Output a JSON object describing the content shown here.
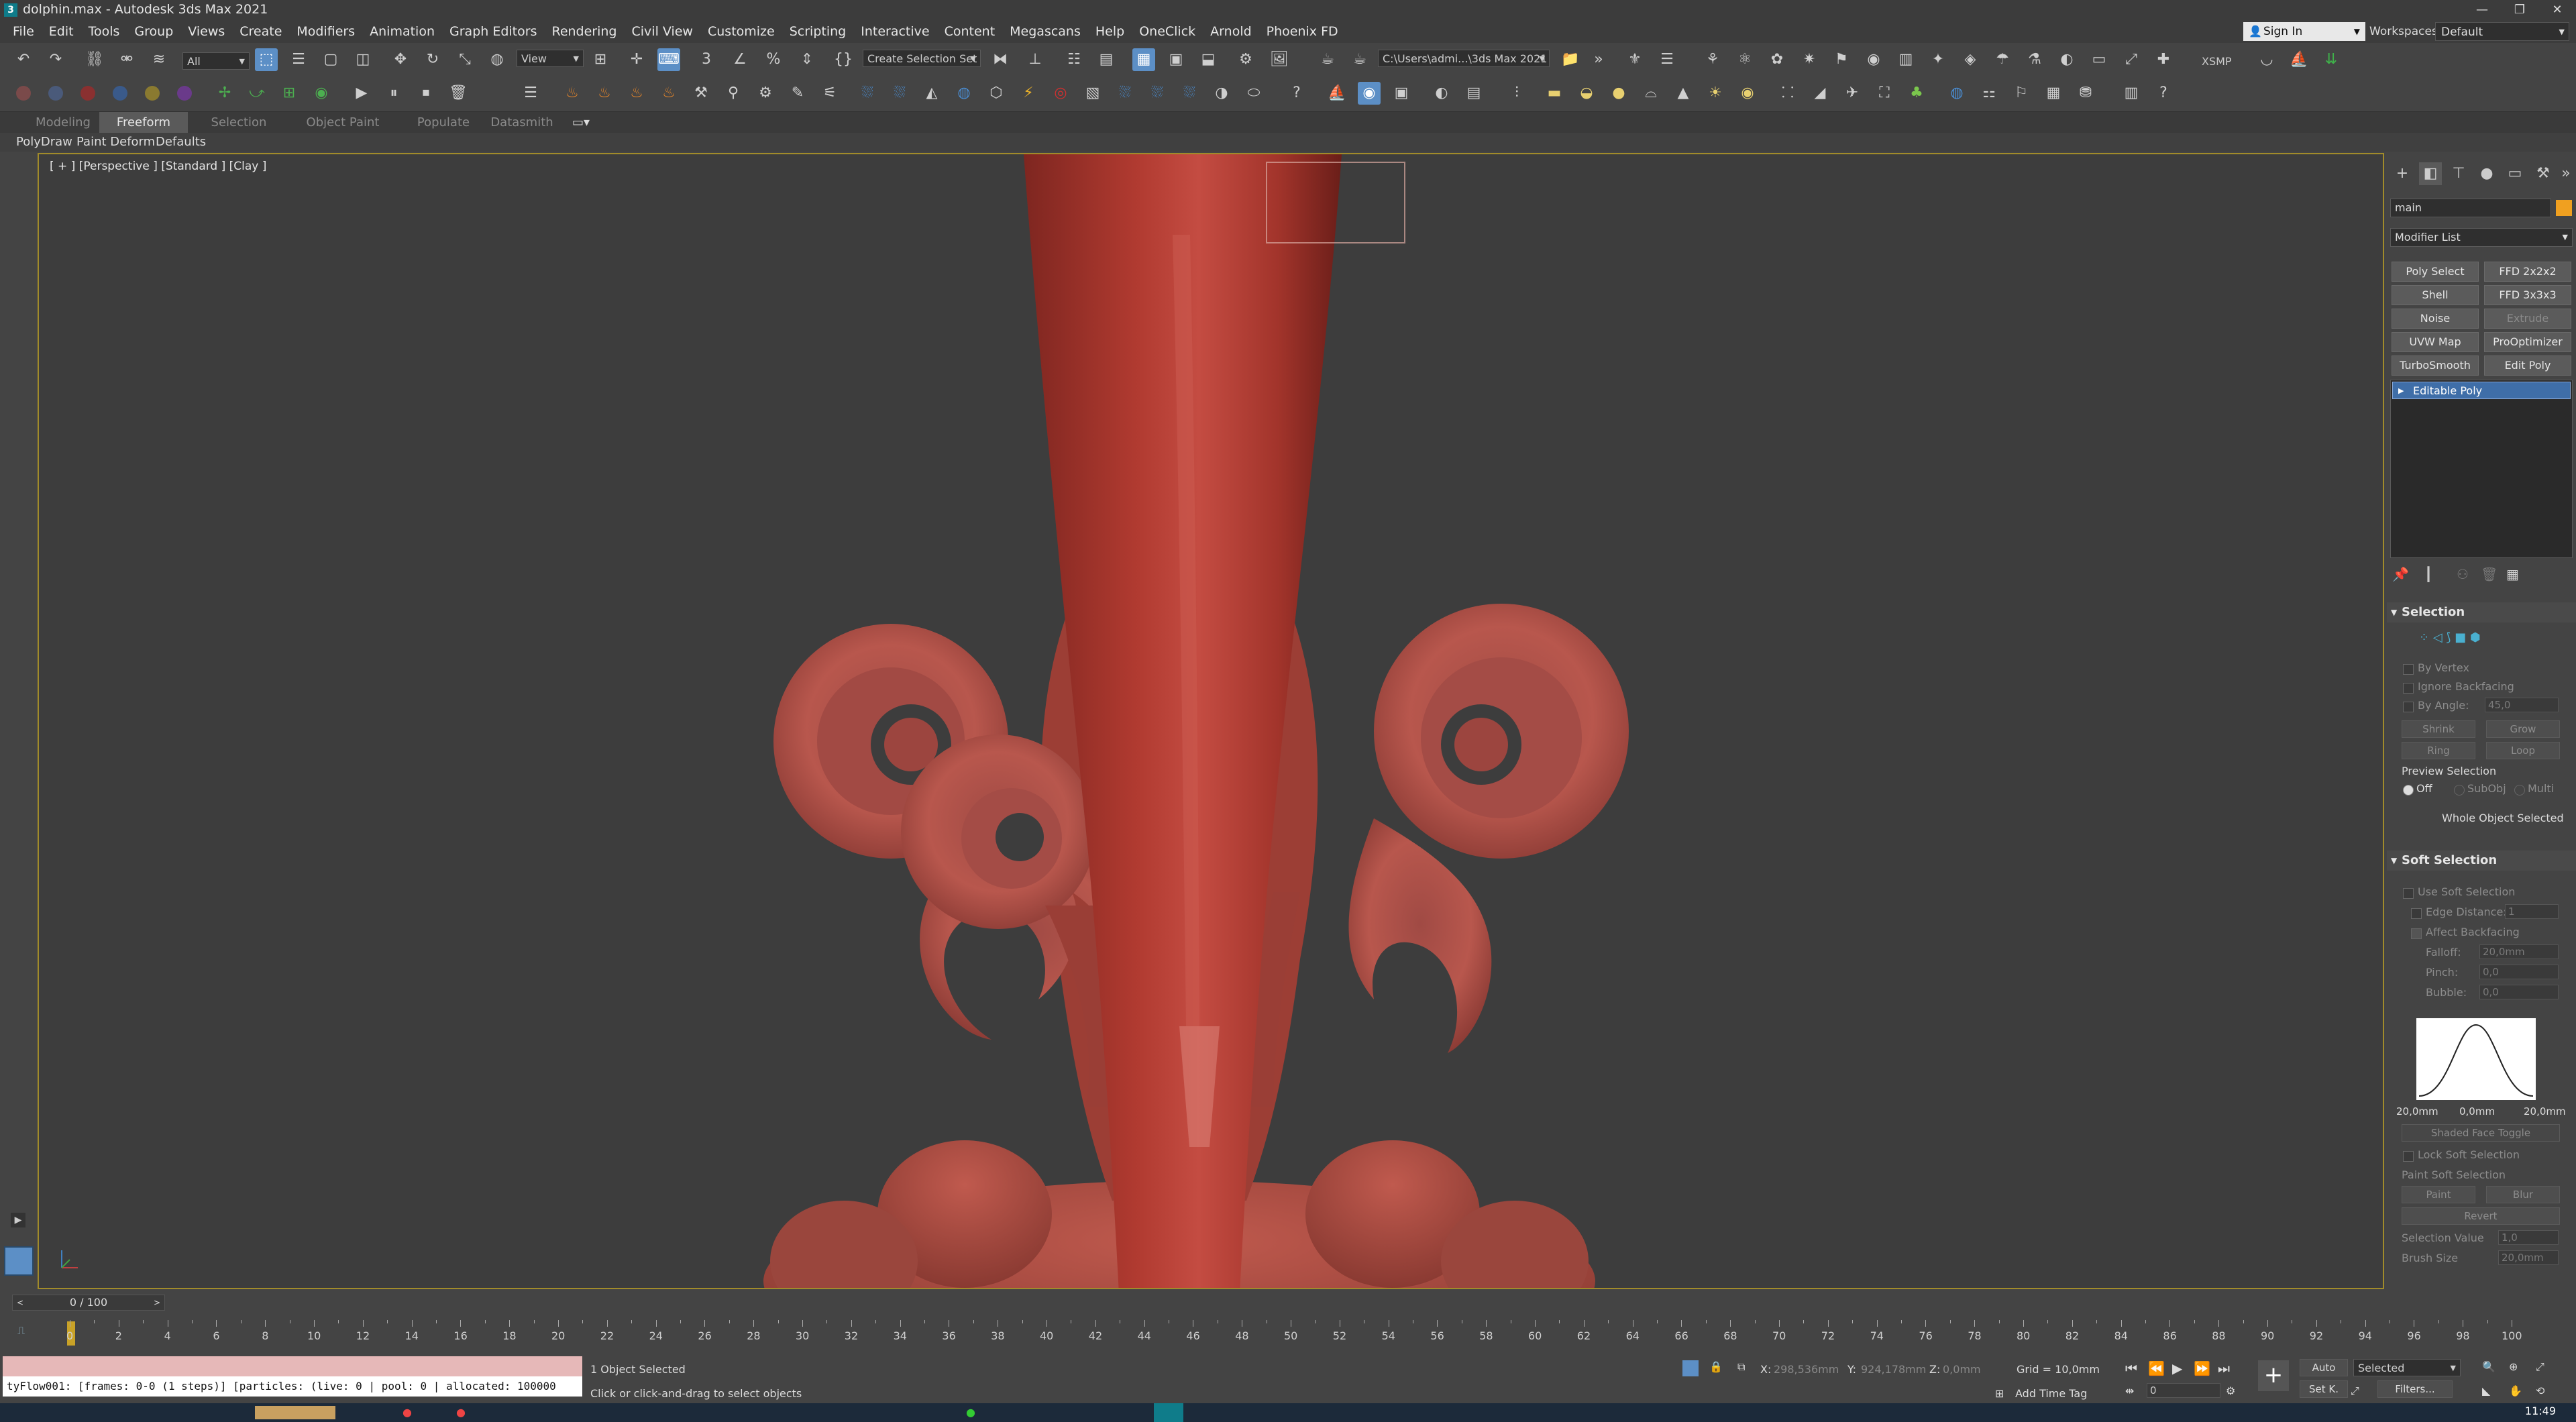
{
  "window": {
    "title": "dolphin.max - Autodesk 3ds Max 2021",
    "app_icon_glyph": "3",
    "minimize": "—",
    "restore": "❐",
    "close": "✕"
  },
  "menu": [
    "File",
    "Edit",
    "Tools",
    "Group",
    "Views",
    "Create",
    "Modifiers",
    "Animation",
    "Graph Editors",
    "Rendering",
    "Civil View",
    "Customize",
    "Scripting",
    "Interactive",
    "Content",
    "Megascans",
    "Help",
    "OneClick",
    "Arnold",
    "Phoenix FD"
  ],
  "signin": {
    "label": "Sign In"
  },
  "workspaces": {
    "label": "Workspaces:",
    "value": "Default"
  },
  "toolbar": {
    "filter_select": "All",
    "view_select": "View",
    "selection_set": "Create Selection Set",
    "project_path": "C:\\Users\\admi...\\3ds Max 2021",
    "xsmp": "XSMP",
    "icons": [
      "undo-icon",
      "redo-icon",
      "link-icon",
      "unlink-icon",
      "bind-spacewarp-icon",
      "select-object-icon",
      "select-by-name-icon",
      "rect-selection-icon",
      "window-crossing-icon",
      "select-move-icon",
      "select-rotate-icon",
      "select-scale-icon",
      "select-place-icon",
      "pivot-icon",
      "keyboard-shortcut-icon",
      "snap-icon",
      "angle-snap-icon",
      "percent-snap-icon",
      "spinner-snap-icon",
      "edit-named-set-icon",
      "mirror-icon",
      "align-icon",
      "layer-explorer-icon",
      "toggle-ribbon-icon",
      "curve-editor-icon",
      "schematic-view-icon",
      "material-editor-icon",
      "render-setup-icon",
      "rendered-frame-icon",
      "render-icon"
    ]
  },
  "ribbon": {
    "tabs": [
      "Modeling",
      "Freeform",
      "Selection",
      "Object Paint",
      "Populate",
      "Datasmith"
    ],
    "active_tab": "Freeform",
    "subtabs": [
      "PolyDraw",
      "Paint Deform",
      "Defaults"
    ]
  },
  "viewport": {
    "label": "[ + ] [Perspective ] [Standard ] [Clay ]",
    "object_color": "#b8473c"
  },
  "command_panel": {
    "object_name": "main",
    "object_color": "#f0a020",
    "modifier_list": "Modifier List",
    "modifier_buttons": [
      {
        "label": "Poly Select",
        "enabled": true
      },
      {
        "label": "FFD 2x2x2",
        "enabled": true
      },
      {
        "label": "Shell",
        "enabled": true
      },
      {
        "label": "FFD 3x3x3",
        "enabled": true
      },
      {
        "label": "Noise",
        "enabled": true
      },
      {
        "label": "Extrude",
        "enabled": false
      },
      {
        "label": "UVW Map",
        "enabled": true
      },
      {
        "label": "ProOptimizer",
        "enabled": true
      },
      {
        "label": "TurboSmooth",
        "enabled": true
      },
      {
        "label": "Edit Poly",
        "enabled": true
      }
    ],
    "stack_item": "Editable Poly",
    "selection": {
      "title": "Selection",
      "by_vertex": "By Vertex",
      "ignore_backfacing": "Ignore Backfacing",
      "by_angle": "By Angle:",
      "by_angle_value": "45,0",
      "shrink": "Shrink",
      "grow": "Grow",
      "ring": "Ring",
      "loop": "Loop",
      "preview_selection": "Preview Selection",
      "off": "Off",
      "subobj": "SubObj",
      "multi": "Multi",
      "status": "Whole Object Selected"
    },
    "soft_selection": {
      "title": "Soft Selection",
      "use": "Use Soft Selection",
      "edge_distance": "Edge Distance:",
      "edge_distance_value": "1",
      "affect_backfacing": "Affect Backfacing",
      "falloff": "Falloff:",
      "falloff_value": "20,0mm",
      "pinch": "Pinch:",
      "pinch_value": "0,0",
      "bubble": "Bubble:",
      "bubble_value": "0,0",
      "curve_left": "20,0mm",
      "curve_mid": "0,0mm",
      "curve_right": "20,0mm",
      "shaded_face_toggle": "Shaded Face Toggle",
      "lock": "Lock Soft Selection",
      "paint_soft": "Paint Soft Selection",
      "paint": "Paint",
      "blur": "Blur",
      "revert": "Revert",
      "selection_value": "Selection Value",
      "selection_value_num": "1,0",
      "brush_size": "Brush Size",
      "brush_size_num": "20,0mm"
    }
  },
  "timeline": {
    "frame_display": "0 / 100",
    "ticks": [
      "0",
      "2",
      "4",
      "6",
      "8",
      "10",
      "12",
      "14",
      "16",
      "18",
      "20",
      "22",
      "24",
      "26",
      "28",
      "30",
      "32",
      "34",
      "36",
      "38",
      "40",
      "42",
      "44",
      "46",
      "48",
      "50",
      "52",
      "54",
      "56",
      "58",
      "60",
      "62",
      "64",
      "66",
      "68",
      "70",
      "72",
      "74",
      "76",
      "78",
      "80",
      "82",
      "84",
      "86",
      "88",
      "90",
      "92",
      "94",
      "96",
      "98",
      "100"
    ]
  },
  "status": {
    "maxscript_output": "tyFlow001: [frames: 0-0 (1 steps)] [particles: (live: 0 | pool: 0 | allocated: 100000",
    "selected": "1 Object Selected",
    "prompt": "Click or click-and-drag to select objects",
    "x_label": "X:",
    "x_value": "298,536mm",
    "y_label": "Y:",
    "y_value": "924,178mm",
    "z_label": "Z:",
    "z_value": "0,0mm",
    "grid": "Grid = 10,0mm",
    "add_time_tag": "Add Time Tag",
    "auto": "Auto",
    "set_key": "Set K.",
    "key_filter": "Selected",
    "filters": "Filters...",
    "frame": "0",
    "clock": "11:49"
  }
}
